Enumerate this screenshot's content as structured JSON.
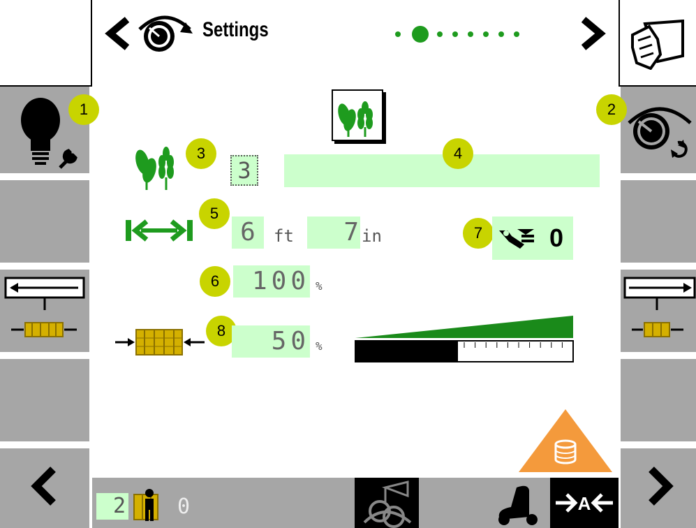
{
  "header": {
    "title": "Settings",
    "page_count": 8,
    "current_page": 2
  },
  "left_buttons": [
    {
      "name": "work-lights",
      "badge": "1"
    },
    {
      "name": "blank-1"
    },
    {
      "name": "bale-length-decrease"
    },
    {
      "name": "blank-2"
    },
    {
      "name": "previous"
    }
  ],
  "right_buttons": [
    {
      "name": "manual"
    },
    {
      "name": "drive-speed",
      "badge": "2"
    },
    {
      "name": "blank-1"
    },
    {
      "name": "bale-length-increase"
    },
    {
      "name": "blank-2"
    },
    {
      "name": "next"
    }
  ],
  "crop": {
    "badge": "3",
    "number": "3",
    "name_badge": "4",
    "name_value": ""
  },
  "bale_length": {
    "badge": "5",
    "feet": "6",
    "feet_unit": "ft",
    "inches": "7",
    "inches_unit": "in"
  },
  "pressure": {
    "badge": "6",
    "value": "100",
    "unit": "%"
  },
  "knotter": {
    "badge": "7",
    "value": "0"
  },
  "density": {
    "badge": "8",
    "value": "50",
    "unit": "%",
    "level": 0.47
  },
  "footer": {
    "operator_number": "2",
    "count": "0"
  },
  "colors": {
    "green": "#1e9b1e",
    "field": "#ccffcc",
    "badge": "#c8d400",
    "button": "#a6a6a6",
    "warning": "#f49a3c"
  }
}
